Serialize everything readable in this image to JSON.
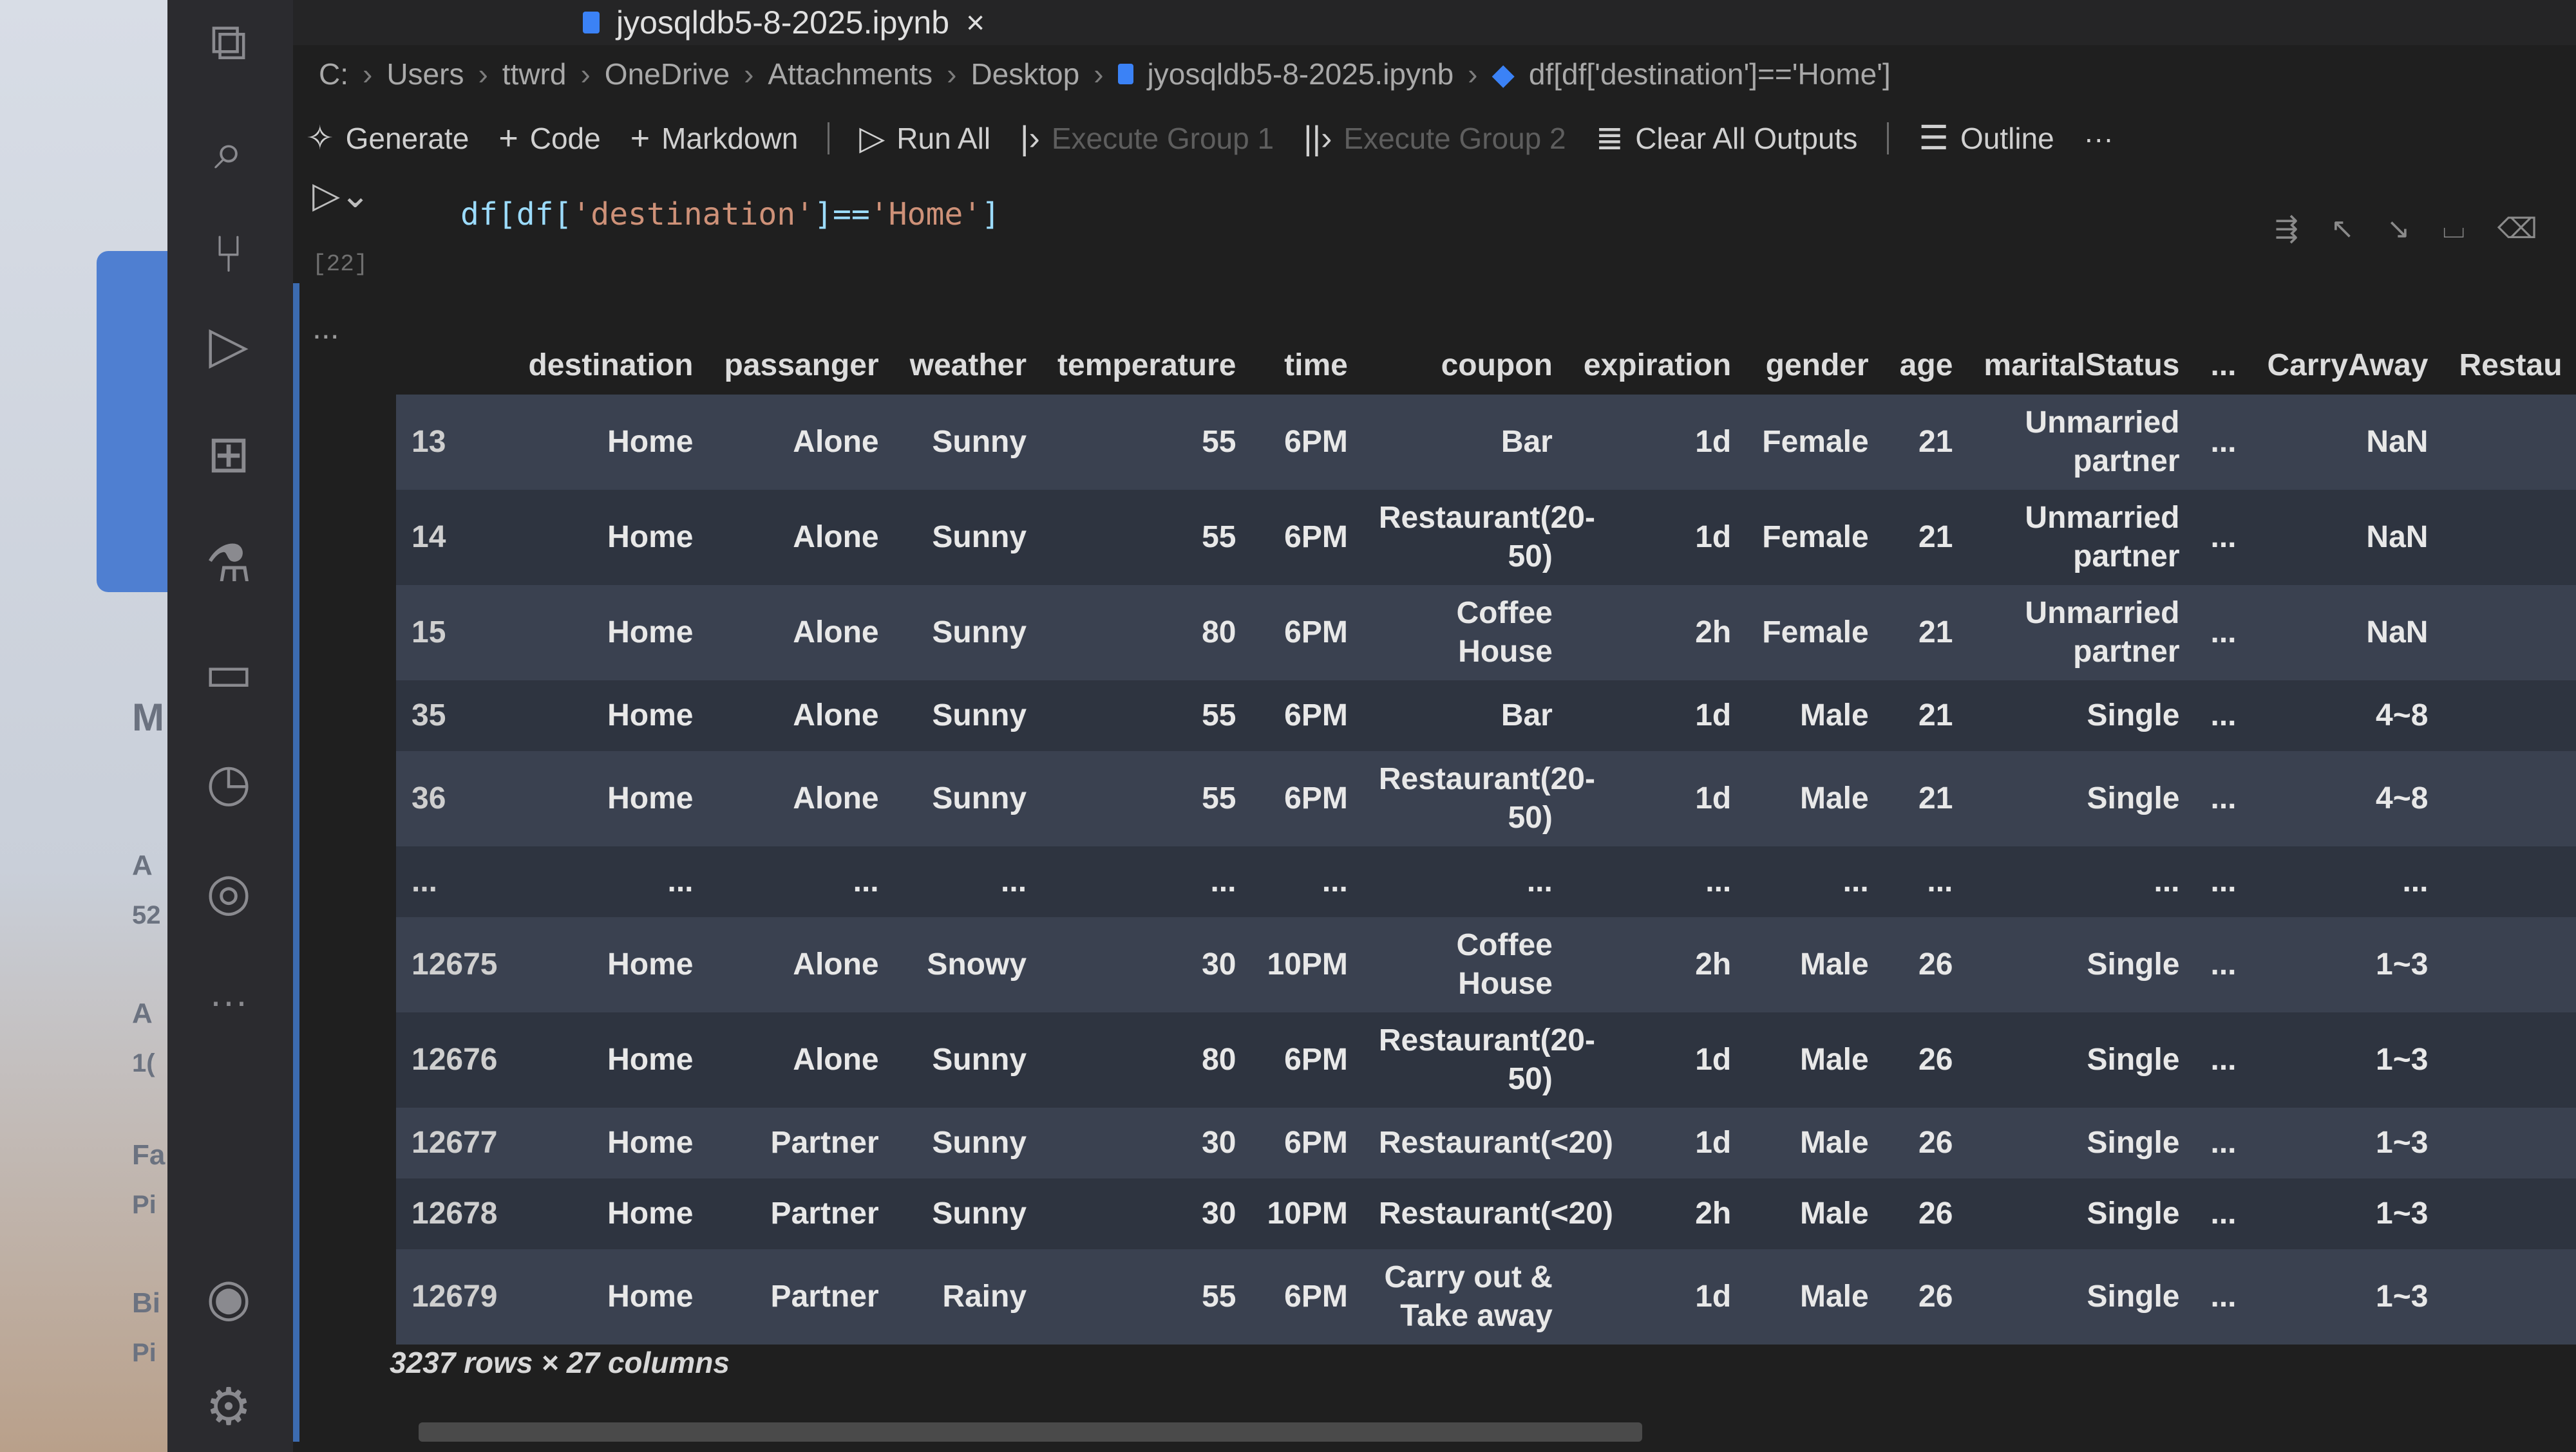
{
  "window": {
    "tab_title": "jyosqldb5-8-2025.ipynb",
    "tab_close": "×"
  },
  "colors": {
    "accent": "#3b82f6",
    "table_row_even": "#2e3440",
    "table_row_odd": "#3a4150"
  },
  "breadcrumb": [
    "C:",
    "Users",
    "ttwrd",
    "OneDrive",
    "Attachments",
    "Desktop",
    "jyosqldb5-8-2025.ipynb",
    "df[df['destination']=='Home']"
  ],
  "toolbar": {
    "generate": "Generate",
    "code": "Code",
    "markdown": "Markdown",
    "run_all": "Run All",
    "execute_group_1": "Execute Group 1",
    "execute_group_2": "Execute Group 2",
    "clear_all_outputs": "Clear All Outputs",
    "outline": "Outline",
    "more": "···"
  },
  "cell": {
    "code_prefix": "df[df[",
    "code_string_1": "'destination'",
    "code_mid": "]==",
    "code_string_2": "'Home'",
    "code_suffix": "]",
    "execution_count": "[22]",
    "output_ellipsis": "..."
  },
  "table": {
    "columns": [
      "",
      "destination",
      "passanger",
      "weather",
      "temperature",
      "time",
      "coupon",
      "expiration",
      "gender",
      "age",
      "maritalStatus",
      "...",
      "CarryAway",
      "Restau"
    ],
    "rows": [
      [
        "13",
        "Home",
        "Alone",
        "Sunny",
        "55",
        "6PM",
        "Bar",
        "1d",
        "Female",
        "21",
        "Unmarried partner",
        "...",
        "NaN",
        ""
      ],
      [
        "14",
        "Home",
        "Alone",
        "Sunny",
        "55",
        "6PM",
        "Restaurant(20-50)",
        "1d",
        "Female",
        "21",
        "Unmarried partner",
        "...",
        "NaN",
        ""
      ],
      [
        "15",
        "Home",
        "Alone",
        "Sunny",
        "80",
        "6PM",
        "Coffee House",
        "2h",
        "Female",
        "21",
        "Unmarried partner",
        "...",
        "NaN",
        ""
      ],
      [
        "35",
        "Home",
        "Alone",
        "Sunny",
        "55",
        "6PM",
        "Bar",
        "1d",
        "Male",
        "21",
        "Single",
        "...",
        "4~8",
        ""
      ],
      [
        "36",
        "Home",
        "Alone",
        "Sunny",
        "55",
        "6PM",
        "Restaurant(20-50)",
        "1d",
        "Male",
        "21",
        "Single",
        "...",
        "4~8",
        ""
      ],
      [
        "...",
        "...",
        "...",
        "...",
        "...",
        "...",
        "...",
        "...",
        "...",
        "...",
        "...",
        "...",
        "...",
        ""
      ],
      [
        "12675",
        "Home",
        "Alone",
        "Snowy",
        "30",
        "10PM",
        "Coffee House",
        "2h",
        "Male",
        "26",
        "Single",
        "...",
        "1~3",
        ""
      ],
      [
        "12676",
        "Home",
        "Alone",
        "Sunny",
        "80",
        "6PM",
        "Restaurant(20-50)",
        "1d",
        "Male",
        "26",
        "Single",
        "...",
        "1~3",
        ""
      ],
      [
        "12677",
        "Home",
        "Partner",
        "Sunny",
        "30",
        "6PM",
        "Restaurant(<20)",
        "1d",
        "Male",
        "26",
        "Single",
        "...",
        "1~3",
        ""
      ],
      [
        "12678",
        "Home",
        "Partner",
        "Sunny",
        "30",
        "10PM",
        "Restaurant(<20)",
        "2h",
        "Male",
        "26",
        "Single",
        "...",
        "1~3",
        ""
      ],
      [
        "12679",
        "Home",
        "Partner",
        "Rainy",
        "55",
        "6PM",
        "Carry out & Take away",
        "1d",
        "Male",
        "26",
        "Single",
        "...",
        "1~3",
        ""
      ]
    ],
    "shape": "3237 rows × 27 columns"
  },
  "activity_bar": [
    {
      "name": "copy-icon",
      "glyph": "⧉"
    },
    {
      "name": "search-icon",
      "glyph": "⌕"
    },
    {
      "name": "source-control-icon",
      "glyph": "⑂"
    },
    {
      "name": "run-debug-icon",
      "glyph": "▷"
    },
    {
      "name": "extensions-icon",
      "glyph": "⊞"
    },
    {
      "name": "testing-icon",
      "glyph": "⚗"
    },
    {
      "name": "folder-icon",
      "glyph": "▭"
    },
    {
      "name": "history-icon",
      "glyph": "◷"
    },
    {
      "name": "remote-explorer-icon",
      "glyph": "◎"
    },
    {
      "name": "more-icon",
      "glyph": "···"
    },
    {
      "name": "account-icon",
      "glyph": "◉"
    },
    {
      "name": "settings-gear-icon",
      "glyph": "⚙"
    }
  ],
  "left_strip_letters": [
    "M",
    "A",
    "52",
    "A",
    "1(",
    "Fa",
    "Pi",
    "Bi",
    "Pi"
  ]
}
